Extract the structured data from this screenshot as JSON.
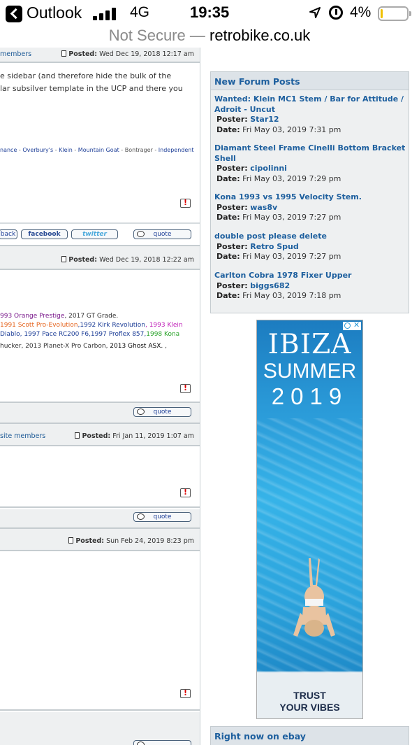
{
  "status_bar": {
    "app_name": "Outlook",
    "network": "4G",
    "time": "19:35",
    "battery_pct": "4%",
    "battery_level": 0.04
  },
  "url_bar": {
    "security": "Not Secure",
    "separator": "—",
    "domain": "retrobike.co.uk"
  },
  "forum": {
    "post1": {
      "members_link": "members",
      "posted_label": "Posted:",
      "posted_date": "Wed Dec 19, 2018 12:17 am",
      "text_line1": "e sidebar (and therefore hide the bulk of the",
      "text_line2": "lar subsilver template in the UCP and there you",
      "sig": [
        "nance",
        "Overbury's",
        "Klein",
        "Mountain Goat",
        "Bontrager",
        "Independent"
      ],
      "share_back": "back",
      "share_facebook": "facebook",
      "share_twitter": "twitter",
      "quote_label": "quote"
    },
    "post2": {
      "posted_label": "Posted:",
      "posted_date": "Wed Dec 19, 2018 12:22 am",
      "sig": {
        "l1_a": "993 Orange Prestige",
        "l1_b": ", 2017 GT Grade.",
        "l2_a": "1991 Scott Pro-Evolution",
        "l2_b": ",1992 Kirk Revolution",
        "l2_c": ", 1993 Klein",
        "l3_a": " Diablo, 1997 Pace RC200 F6,1997 Proflex 857,",
        "l3_b": "1998 Kona",
        "l4_a": "hucker, 2013 Planet-X Pro Carbon, ",
        "l4_b": "2013 Ghost ASX.",
        "l4_c": " ,"
      },
      "quote_label": "quote"
    },
    "post3": {
      "members_link": "site members",
      "posted_label": "Posted:",
      "posted_date": "Fri Jan 11, 2019 1:07 am",
      "quote_label": "quote"
    },
    "post4": {
      "posted_label": "Posted:",
      "posted_date": "Sun Feb 24, 2019 8:23 pm"
    }
  },
  "new_posts": {
    "title": "New Forum Posts",
    "poster_label": "Poster:",
    "date_label": "Date:",
    "items": [
      {
        "title": "Wanted: Klein MC1 Stem / Bar for Attitude / Adroit - Uncut",
        "poster": "Star12",
        "date": "Fri May 03, 2019 7:31 pm"
      },
      {
        "title": "Diamant Steel Frame Cinelli Bottom Bracket Shell",
        "poster": "cipolinni",
        "date": "Fri May 03, 2019 7:29 pm"
      },
      {
        "title": "Kona 1993 vs 1995 Velocity Stem.",
        "poster": "was8v",
        "date": "Fri May 03, 2019 7:27 pm"
      },
      {
        "title": "double post please delete",
        "poster": "Retro Spud",
        "date": "Fri May 03, 2019 7:27 pm"
      },
      {
        "title": "Carlton Cobra 1978 Fixer Upper",
        "poster": "biggs682",
        "date": "Fri May 03, 2019 7:18 pm"
      }
    ]
  },
  "ad": {
    "line1": "IBIZA",
    "line2": "SUMMER",
    "line3": "2019",
    "tagline1": "TRUST",
    "tagline2": "YOUR VIBES",
    "close_icon": "close-icon",
    "info_icon": "adchoices-icon"
  },
  "ebay": {
    "title": "Right now on ebay"
  }
}
